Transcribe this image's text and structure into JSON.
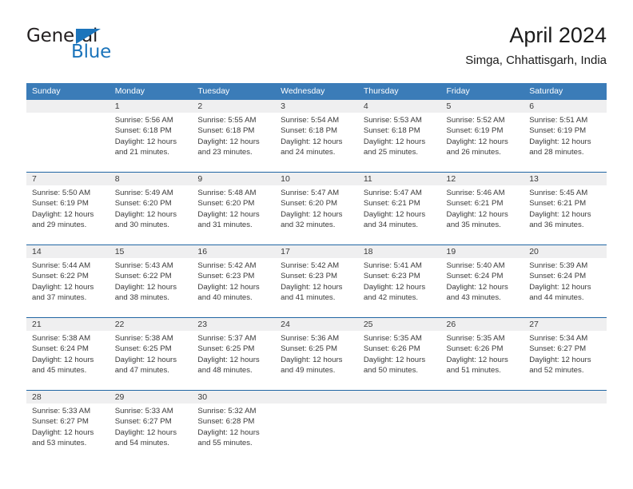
{
  "brand": {
    "name_top": "General",
    "name_bottom": "Blue",
    "accent_color": "#1b74bb"
  },
  "header": {
    "title": "April 2024",
    "subtitle": "Simga, Chhattisgarh, India"
  },
  "theme": {
    "header_row_bg": "#3b7cb8",
    "week_divider": "#2166a4",
    "day_band_bg": "#efeff0",
    "text_color": "#3a3a3a"
  },
  "weekdays": [
    "Sunday",
    "Monday",
    "Tuesday",
    "Wednesday",
    "Thursday",
    "Friday",
    "Saturday"
  ],
  "weeks": [
    [
      {
        "day": "",
        "sunrise": "",
        "sunset": "",
        "daylight": "",
        "daylight2": "",
        "empty": true
      },
      {
        "day": "1",
        "sunrise": "Sunrise: 5:56 AM",
        "sunset": "Sunset: 6:18 PM",
        "daylight": "Daylight: 12 hours",
        "daylight2": "and 21 minutes."
      },
      {
        "day": "2",
        "sunrise": "Sunrise: 5:55 AM",
        "sunset": "Sunset: 6:18 PM",
        "daylight": "Daylight: 12 hours",
        "daylight2": "and 23 minutes."
      },
      {
        "day": "3",
        "sunrise": "Sunrise: 5:54 AM",
        "sunset": "Sunset: 6:18 PM",
        "daylight": "Daylight: 12 hours",
        "daylight2": "and 24 minutes."
      },
      {
        "day": "4",
        "sunrise": "Sunrise: 5:53 AM",
        "sunset": "Sunset: 6:18 PM",
        "daylight": "Daylight: 12 hours",
        "daylight2": "and 25 minutes."
      },
      {
        "day": "5",
        "sunrise": "Sunrise: 5:52 AM",
        "sunset": "Sunset: 6:19 PM",
        "daylight": "Daylight: 12 hours",
        "daylight2": "and 26 minutes."
      },
      {
        "day": "6",
        "sunrise": "Sunrise: 5:51 AM",
        "sunset": "Sunset: 6:19 PM",
        "daylight": "Daylight: 12 hours",
        "daylight2": "and 28 minutes."
      }
    ],
    [
      {
        "day": "7",
        "sunrise": "Sunrise: 5:50 AM",
        "sunset": "Sunset: 6:19 PM",
        "daylight": "Daylight: 12 hours",
        "daylight2": "and 29 minutes."
      },
      {
        "day": "8",
        "sunrise": "Sunrise: 5:49 AM",
        "sunset": "Sunset: 6:20 PM",
        "daylight": "Daylight: 12 hours",
        "daylight2": "and 30 minutes."
      },
      {
        "day": "9",
        "sunrise": "Sunrise: 5:48 AM",
        "sunset": "Sunset: 6:20 PM",
        "daylight": "Daylight: 12 hours",
        "daylight2": "and 31 minutes."
      },
      {
        "day": "10",
        "sunrise": "Sunrise: 5:47 AM",
        "sunset": "Sunset: 6:20 PM",
        "daylight": "Daylight: 12 hours",
        "daylight2": "and 32 minutes."
      },
      {
        "day": "11",
        "sunrise": "Sunrise: 5:47 AM",
        "sunset": "Sunset: 6:21 PM",
        "daylight": "Daylight: 12 hours",
        "daylight2": "and 34 minutes."
      },
      {
        "day": "12",
        "sunrise": "Sunrise: 5:46 AM",
        "sunset": "Sunset: 6:21 PM",
        "daylight": "Daylight: 12 hours",
        "daylight2": "and 35 minutes."
      },
      {
        "day": "13",
        "sunrise": "Sunrise: 5:45 AM",
        "sunset": "Sunset: 6:21 PM",
        "daylight": "Daylight: 12 hours",
        "daylight2": "and 36 minutes."
      }
    ],
    [
      {
        "day": "14",
        "sunrise": "Sunrise: 5:44 AM",
        "sunset": "Sunset: 6:22 PM",
        "daylight": "Daylight: 12 hours",
        "daylight2": "and 37 minutes."
      },
      {
        "day": "15",
        "sunrise": "Sunrise: 5:43 AM",
        "sunset": "Sunset: 6:22 PM",
        "daylight": "Daylight: 12 hours",
        "daylight2": "and 38 minutes."
      },
      {
        "day": "16",
        "sunrise": "Sunrise: 5:42 AM",
        "sunset": "Sunset: 6:23 PM",
        "daylight": "Daylight: 12 hours",
        "daylight2": "and 40 minutes."
      },
      {
        "day": "17",
        "sunrise": "Sunrise: 5:42 AM",
        "sunset": "Sunset: 6:23 PM",
        "daylight": "Daylight: 12 hours",
        "daylight2": "and 41 minutes."
      },
      {
        "day": "18",
        "sunrise": "Sunrise: 5:41 AM",
        "sunset": "Sunset: 6:23 PM",
        "daylight": "Daylight: 12 hours",
        "daylight2": "and 42 minutes."
      },
      {
        "day": "19",
        "sunrise": "Sunrise: 5:40 AM",
        "sunset": "Sunset: 6:24 PM",
        "daylight": "Daylight: 12 hours",
        "daylight2": "and 43 minutes."
      },
      {
        "day": "20",
        "sunrise": "Sunrise: 5:39 AM",
        "sunset": "Sunset: 6:24 PM",
        "daylight": "Daylight: 12 hours",
        "daylight2": "and 44 minutes."
      }
    ],
    [
      {
        "day": "21",
        "sunrise": "Sunrise: 5:38 AM",
        "sunset": "Sunset: 6:24 PM",
        "daylight": "Daylight: 12 hours",
        "daylight2": "and 45 minutes."
      },
      {
        "day": "22",
        "sunrise": "Sunrise: 5:38 AM",
        "sunset": "Sunset: 6:25 PM",
        "daylight": "Daylight: 12 hours",
        "daylight2": "and 47 minutes."
      },
      {
        "day": "23",
        "sunrise": "Sunrise: 5:37 AM",
        "sunset": "Sunset: 6:25 PM",
        "daylight": "Daylight: 12 hours",
        "daylight2": "and 48 minutes."
      },
      {
        "day": "24",
        "sunrise": "Sunrise: 5:36 AM",
        "sunset": "Sunset: 6:25 PM",
        "daylight": "Daylight: 12 hours",
        "daylight2": "and 49 minutes."
      },
      {
        "day": "25",
        "sunrise": "Sunrise: 5:35 AM",
        "sunset": "Sunset: 6:26 PM",
        "daylight": "Daylight: 12 hours",
        "daylight2": "and 50 minutes."
      },
      {
        "day": "26",
        "sunrise": "Sunrise: 5:35 AM",
        "sunset": "Sunset: 6:26 PM",
        "daylight": "Daylight: 12 hours",
        "daylight2": "and 51 minutes."
      },
      {
        "day": "27",
        "sunrise": "Sunrise: 5:34 AM",
        "sunset": "Sunset: 6:27 PM",
        "daylight": "Daylight: 12 hours",
        "daylight2": "and 52 minutes."
      }
    ],
    [
      {
        "day": "28",
        "sunrise": "Sunrise: 5:33 AM",
        "sunset": "Sunset: 6:27 PM",
        "daylight": "Daylight: 12 hours",
        "daylight2": "and 53 minutes."
      },
      {
        "day": "29",
        "sunrise": "Sunrise: 5:33 AM",
        "sunset": "Sunset: 6:27 PM",
        "daylight": "Daylight: 12 hours",
        "daylight2": "and 54 minutes."
      },
      {
        "day": "30",
        "sunrise": "Sunrise: 5:32 AM",
        "sunset": "Sunset: 6:28 PM",
        "daylight": "Daylight: 12 hours",
        "daylight2": "and 55 minutes."
      },
      {
        "day": "",
        "sunrise": "",
        "sunset": "",
        "daylight": "",
        "daylight2": "",
        "empty": true
      },
      {
        "day": "",
        "sunrise": "",
        "sunset": "",
        "daylight": "",
        "daylight2": "",
        "empty": true
      },
      {
        "day": "",
        "sunrise": "",
        "sunset": "",
        "daylight": "",
        "daylight2": "",
        "empty": true
      },
      {
        "day": "",
        "sunrise": "",
        "sunset": "",
        "daylight": "",
        "daylight2": "",
        "empty": true
      }
    ]
  ]
}
